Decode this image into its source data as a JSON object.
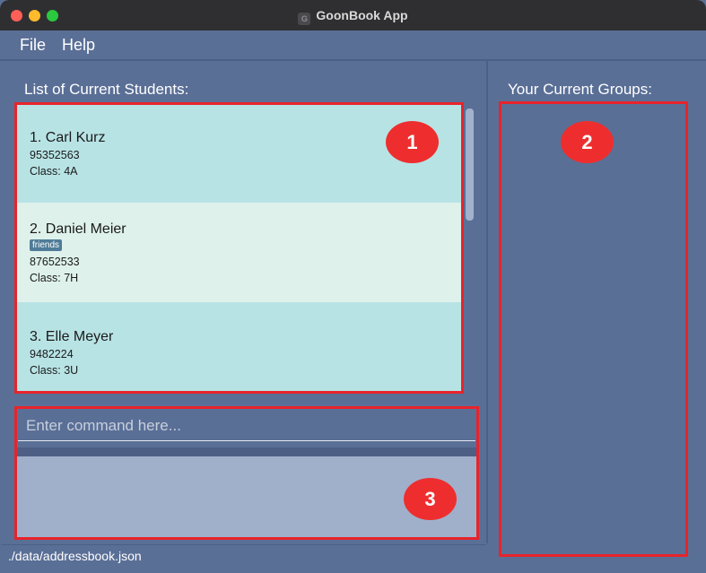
{
  "window": {
    "title": "GoonBook App",
    "app_icon": "goonbook-logo-icon"
  },
  "menu": {
    "file": "File",
    "help": "Help"
  },
  "students_panel": {
    "heading": "List of Current Students:",
    "students": [
      {
        "name": "1. Carl Kurz",
        "phone": "95352563",
        "class": "Class: 4A",
        "tags": []
      },
      {
        "name": "2. Daniel Meier",
        "phone": "87652533",
        "class": "Class: 7H",
        "tags": [
          "friends"
        ]
      },
      {
        "name": "3. Elle Meyer",
        "phone": "9482224",
        "class": "Class: 3U",
        "tags": []
      }
    ]
  },
  "groups_panel": {
    "heading": "Your Current Groups:"
  },
  "command": {
    "placeholder": "Enter command here...",
    "value": ""
  },
  "result": {
    "text": ""
  },
  "status": {
    "path": "./data/addressbook.json"
  },
  "annotations": [
    {
      "label": "1"
    },
    {
      "label": "2"
    },
    {
      "label": "3"
    }
  ],
  "colors": {
    "window_bg": "#5a6f96",
    "card_alt_1": "#b8e3e5",
    "card_alt_2": "#def1eb",
    "result_bg": "#a0b0cb",
    "annotation_red": "#e8232b"
  }
}
